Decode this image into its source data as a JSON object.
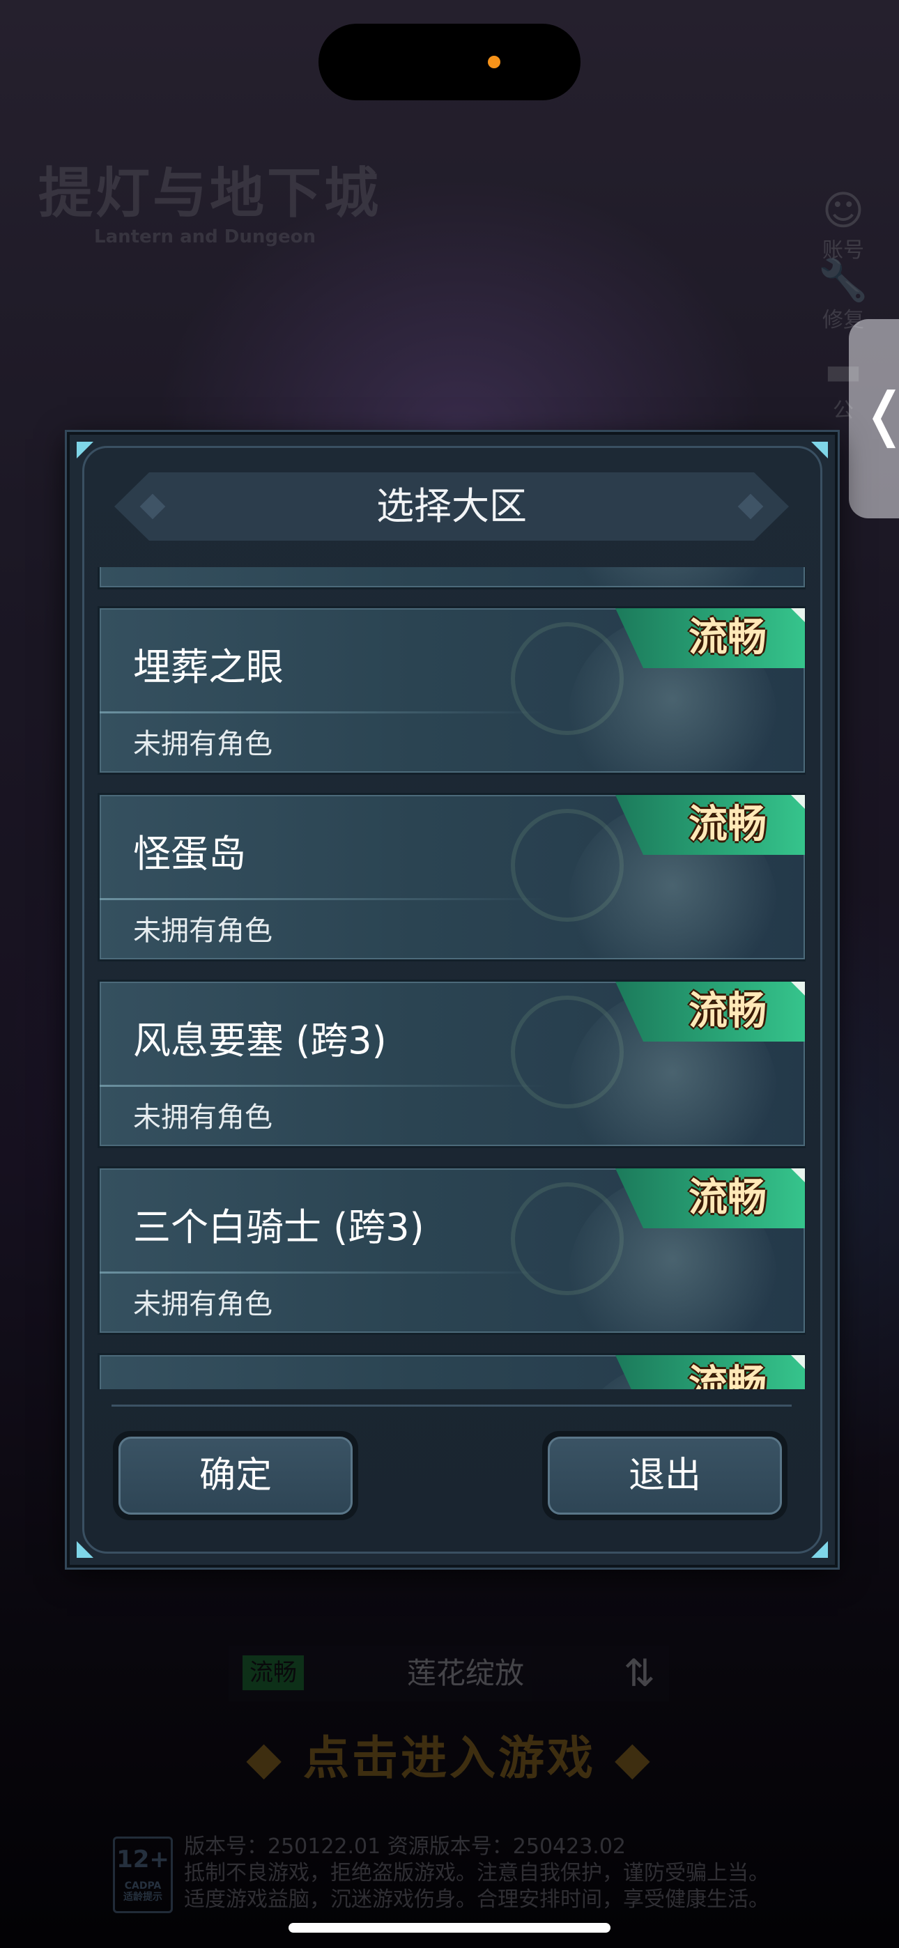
{
  "background": {
    "logo_cn": "提灯与地下城",
    "logo_en": "Lantern and Dungeon",
    "side_icons": [
      {
        "icon": "user-icon",
        "label": "账号"
      },
      {
        "icon": "wrench-icon",
        "label": "修复"
      },
      {
        "icon": "megaphone-icon",
        "label": "公"
      }
    ],
    "current_server": {
      "status": "流畅",
      "name": "莲花绽放"
    },
    "enter_game": "◆ 点击进入游戏 ◆",
    "age_rating": "12+",
    "age_rating_org": "CADPA",
    "age_rating_sub": "适龄提示",
    "version_line": "版本号：250122.01 资源版本号：250423.02",
    "notice_line1": "抵制不良游戏，拒绝盗版游戏。注意自我保护，谨防受骗上当。",
    "notice_line2": "适度游戏益脑，沉迷游戏伤身。合理安排时间，享受健康生活。"
  },
  "dialog": {
    "title": "选择大区",
    "servers": [
      {
        "name": "埋葬之眼",
        "role_text": "未拥有角色",
        "status": "流畅"
      },
      {
        "name": "怪蛋岛",
        "role_text": "未拥有角色",
        "status": "流畅"
      },
      {
        "name": "风息要塞 (跨3)",
        "role_text": "未拥有角色",
        "status": "流畅"
      },
      {
        "name": "三个白骑士 (跨3)",
        "role_text": "未拥有角色",
        "status": "流畅"
      },
      {
        "name": "",
        "role_text": "",
        "status": "流畅"
      }
    ],
    "confirm_label": "确定",
    "exit_label": "退出"
  },
  "colors": {
    "status_green": "#2aa778",
    "status_text": "#ffe9b8",
    "dialog_bg": "#1e2a36",
    "accent_corner": "#7fd6e8"
  }
}
